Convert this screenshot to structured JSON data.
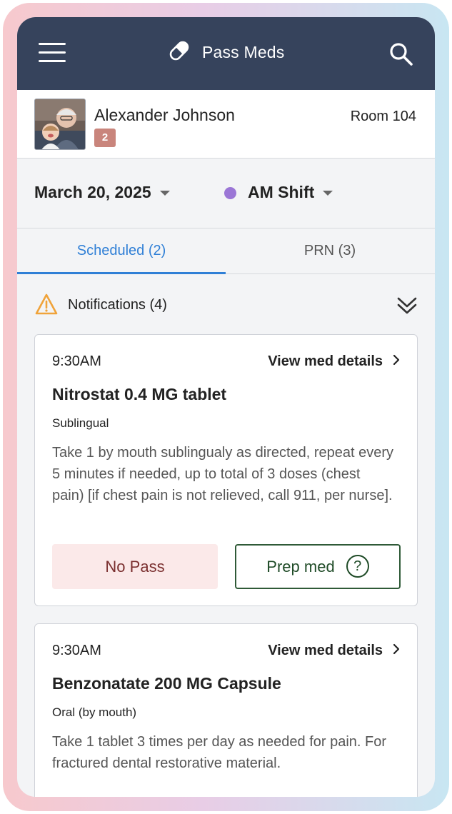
{
  "header": {
    "title": "Pass Meds",
    "menu_icon": "hamburger-menu-icon",
    "logo_icon": "pill-icon",
    "search_icon": "search-icon",
    "bg_color": "#36435c"
  },
  "patient": {
    "name": "Alexander Johnson",
    "badge": "2",
    "room": "Room 104"
  },
  "filters": {
    "date": "March 20, 2025",
    "shift": "AM Shift",
    "shift_color": "#9b76d6"
  },
  "tabs": [
    {
      "label": "Scheduled (2)",
      "active": true
    },
    {
      "label": "PRN (3)",
      "active": false
    }
  ],
  "notifications": {
    "label": "Notifications (4)",
    "icon": "warning-icon",
    "toggle_icon": "double-chevron-down-icon"
  },
  "meds": [
    {
      "time": "9:30AM",
      "details_label": "View med details",
      "name": "Nitrostat 0.4 MG tablet",
      "route": "Sublingual",
      "instructions": "Take 1 by mouth sublingualy as directed, repeat every 5 minutes if needed, up to total of 3 doses (chest pain) [if chest pain is not relieved, call 911, per nurse].",
      "no_pass_label": "No Pass",
      "prep_label": "Prep med"
    },
    {
      "time": "9:30AM",
      "details_label": "View med details",
      "name": "Benzonatate 200 MG Capsule",
      "route": "Oral (by mouth)",
      "instructions": "Take 1 tablet 3 times per day as needed for pain. For fractured dental restorative material."
    }
  ]
}
